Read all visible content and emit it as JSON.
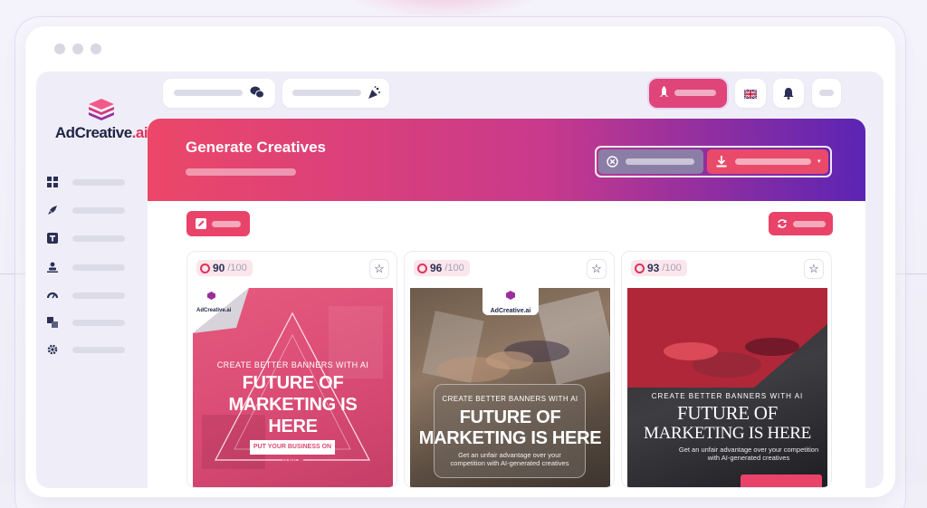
{
  "brand": {
    "logo_text": "AdCreative",
    "logo_suffix": ".ai"
  },
  "colors": {
    "accent": "#e9436a",
    "gradient_start": "#ec4768",
    "gradient_end": "#5b24b4",
    "dark": "#2b2f55"
  },
  "sidebar": {
    "items": [
      {
        "icon": "dashboard-icon"
      },
      {
        "icon": "rocket-icon"
      },
      {
        "icon": "text-icon"
      },
      {
        "icon": "audience-icon"
      },
      {
        "icon": "gauge-icon"
      },
      {
        "icon": "layers-icon"
      },
      {
        "icon": "gear-icon"
      }
    ]
  },
  "topbar": {
    "icons": [
      "chat-icon",
      "confetti-icon",
      "rocket-icon",
      "flag-uk-icon",
      "bell-icon"
    ]
  },
  "hero": {
    "title": "Generate Creatives"
  },
  "cards": [
    {
      "score": "90",
      "score_max": "/100",
      "banner": {
        "logo": "AdCreative.ai",
        "tagline": "CREATE BETTER BANNERS WITH AI",
        "headline_1": "FUTURE OF",
        "headline_2": "MARKETING IS",
        "headline_3": "HERE",
        "cta": "PUT YOUR BUSINESS ON TOP! ❤"
      }
    },
    {
      "score": "96",
      "score_max": "/100",
      "banner": {
        "logo": "AdCreative.ai",
        "tagline": "CREATE BETTER BANNERS WITH AI",
        "headline_1": "FUTURE OF",
        "headline_2": "MARKETING IS HERE",
        "body": "Get an unfair advantage over your competition with AI-generated creatives"
      }
    },
    {
      "score": "93",
      "score_max": "/100",
      "banner": {
        "tagline": "CREATE BETTER BANNERS WITH AI",
        "headline_1": "FUTURE OF",
        "headline_2": "MARKETING IS HERE",
        "body": "Get an unfair advantage over your competition with AI-generated creatives"
      }
    }
  ]
}
